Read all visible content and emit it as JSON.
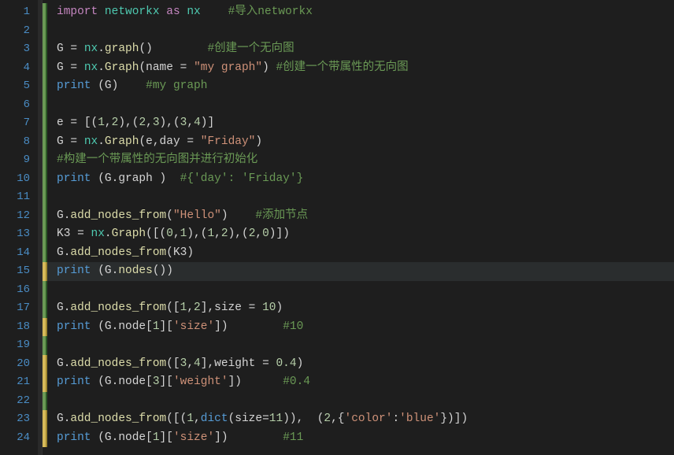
{
  "lines": [
    {
      "num": 1,
      "marker": "green",
      "current": false,
      "tokens": [
        [
          "kw",
          "import"
        ],
        [
          "id",
          " "
        ],
        [
          "mod",
          "networkx"
        ],
        [
          "id",
          " "
        ],
        [
          "kw",
          "as"
        ],
        [
          "id",
          " "
        ],
        [
          "fn",
          "nx"
        ],
        [
          "id",
          "    "
        ],
        [
          "cmt",
          "#导入networkx"
        ]
      ]
    },
    {
      "num": 2,
      "marker": "green",
      "current": false,
      "tokens": []
    },
    {
      "num": 3,
      "marker": "green",
      "current": false,
      "tokens": [
        [
          "id",
          "G "
        ],
        [
          "op",
          "="
        ],
        [
          "id",
          " "
        ],
        [
          "fn",
          "nx"
        ],
        [
          "punc",
          "."
        ],
        [
          "call",
          "graph"
        ],
        [
          "punc",
          "()"
        ],
        [
          "id",
          "        "
        ],
        [
          "cmt",
          "#创建一个无向图"
        ]
      ]
    },
    {
      "num": 4,
      "marker": "green",
      "current": false,
      "tokens": [
        [
          "id",
          "G "
        ],
        [
          "op",
          "="
        ],
        [
          "id",
          " "
        ],
        [
          "fn",
          "nx"
        ],
        [
          "punc",
          "."
        ],
        [
          "call",
          "Graph"
        ],
        [
          "punc",
          "("
        ],
        [
          "id",
          "name "
        ],
        [
          "op",
          "="
        ],
        [
          "id",
          " "
        ],
        [
          "str",
          "\"my graph\""
        ],
        [
          "punc",
          ")"
        ],
        [
          "id",
          " "
        ],
        [
          "cmt",
          "#创建一个带属性的无向图"
        ]
      ]
    },
    {
      "num": 5,
      "marker": "green",
      "current": false,
      "tokens": [
        [
          "pr",
          "print"
        ],
        [
          "id",
          " "
        ],
        [
          "punc",
          "("
        ],
        [
          "id",
          "G"
        ],
        [
          "punc",
          ")"
        ],
        [
          "id",
          "    "
        ],
        [
          "cmt",
          "#my graph"
        ]
      ]
    },
    {
      "num": 6,
      "marker": "green",
      "current": false,
      "tokens": []
    },
    {
      "num": 7,
      "marker": "green",
      "current": false,
      "tokens": [
        [
          "id",
          "e "
        ],
        [
          "op",
          "="
        ],
        [
          "id",
          " "
        ],
        [
          "punc",
          "[("
        ],
        [
          "num",
          "1"
        ],
        [
          "punc",
          ","
        ],
        [
          "num",
          "2"
        ],
        [
          "punc",
          "),("
        ],
        [
          "num",
          "2"
        ],
        [
          "punc",
          ","
        ],
        [
          "num",
          "3"
        ],
        [
          "punc",
          "),("
        ],
        [
          "num",
          "3"
        ],
        [
          "punc",
          ","
        ],
        [
          "num",
          "4"
        ],
        [
          "punc",
          ")]"
        ]
      ]
    },
    {
      "num": 8,
      "marker": "green",
      "current": false,
      "tokens": [
        [
          "id",
          "G "
        ],
        [
          "op",
          "="
        ],
        [
          "id",
          " "
        ],
        [
          "fn",
          "nx"
        ],
        [
          "punc",
          "."
        ],
        [
          "call",
          "Graph"
        ],
        [
          "punc",
          "("
        ],
        [
          "id",
          "e"
        ],
        [
          "punc",
          ","
        ],
        [
          "id",
          "day "
        ],
        [
          "op",
          "="
        ],
        [
          "id",
          " "
        ],
        [
          "str",
          "\"Friday\""
        ],
        [
          "punc",
          ")"
        ]
      ]
    },
    {
      "num": 9,
      "marker": "green",
      "current": false,
      "tokens": [
        [
          "cmt",
          "#构建一个带属性的无向图并进行初始化"
        ]
      ]
    },
    {
      "num": 10,
      "marker": "green",
      "current": false,
      "tokens": [
        [
          "pr",
          "print"
        ],
        [
          "id",
          " "
        ],
        [
          "punc",
          "("
        ],
        [
          "id",
          "G"
        ],
        [
          "punc",
          "."
        ],
        [
          "id",
          "graph "
        ],
        [
          "punc",
          ")"
        ],
        [
          "id",
          "  "
        ],
        [
          "cmt",
          "#{'day': 'Friday'}"
        ]
      ]
    },
    {
      "num": 11,
      "marker": "green",
      "current": false,
      "tokens": []
    },
    {
      "num": 12,
      "marker": "green",
      "current": false,
      "tokens": [
        [
          "id",
          "G"
        ],
        [
          "punc",
          "."
        ],
        [
          "call",
          "add_nodes_from"
        ],
        [
          "punc",
          "("
        ],
        [
          "str",
          "\"Hello\""
        ],
        [
          "punc",
          ")"
        ],
        [
          "id",
          "    "
        ],
        [
          "cmt",
          "#添加节点"
        ]
      ]
    },
    {
      "num": 13,
      "marker": "green",
      "current": false,
      "tokens": [
        [
          "id",
          "K3 "
        ],
        [
          "op",
          "="
        ],
        [
          "id",
          " "
        ],
        [
          "fn",
          "nx"
        ],
        [
          "punc",
          "."
        ],
        [
          "call",
          "Graph"
        ],
        [
          "punc",
          "([("
        ],
        [
          "num",
          "0"
        ],
        [
          "punc",
          ","
        ],
        [
          "num",
          "1"
        ],
        [
          "punc",
          "),("
        ],
        [
          "num",
          "1"
        ],
        [
          "punc",
          ","
        ],
        [
          "num",
          "2"
        ],
        [
          "punc",
          "),("
        ],
        [
          "num",
          "2"
        ],
        [
          "punc",
          ","
        ],
        [
          "num",
          "0"
        ],
        [
          "punc",
          ")])"
        ]
      ]
    },
    {
      "num": 14,
      "marker": "green",
      "current": false,
      "tokens": [
        [
          "id",
          "G"
        ],
        [
          "punc",
          "."
        ],
        [
          "call",
          "add_nodes_from"
        ],
        [
          "punc",
          "("
        ],
        [
          "id",
          "K3"
        ],
        [
          "punc",
          ")"
        ]
      ]
    },
    {
      "num": 15,
      "marker": "yellow",
      "current": true,
      "tokens": [
        [
          "pr",
          "print"
        ],
        [
          "id",
          " "
        ],
        [
          "punc",
          "("
        ],
        [
          "id",
          "G"
        ],
        [
          "punc",
          "."
        ],
        [
          "call",
          "nodes"
        ],
        [
          "punc",
          "())"
        ]
      ]
    },
    {
      "num": 16,
      "marker": "green",
      "current": false,
      "tokens": []
    },
    {
      "num": 17,
      "marker": "green",
      "current": false,
      "tokens": [
        [
          "id",
          "G"
        ],
        [
          "punc",
          "."
        ],
        [
          "call",
          "add_nodes_from"
        ],
        [
          "punc",
          "(["
        ],
        [
          "num",
          "1"
        ],
        [
          "punc",
          ","
        ],
        [
          "num",
          "2"
        ],
        [
          "punc",
          "],"
        ],
        [
          "id",
          "size "
        ],
        [
          "op",
          "="
        ],
        [
          "id",
          " "
        ],
        [
          "num",
          "10"
        ],
        [
          "punc",
          ")"
        ]
      ]
    },
    {
      "num": 18,
      "marker": "yellow",
      "current": false,
      "tokens": [
        [
          "pr",
          "print"
        ],
        [
          "id",
          " "
        ],
        [
          "punc",
          "("
        ],
        [
          "id",
          "G"
        ],
        [
          "punc",
          "."
        ],
        [
          "id",
          "node"
        ],
        [
          "punc",
          "["
        ],
        [
          "num",
          "1"
        ],
        [
          "punc",
          "]["
        ],
        [
          "str",
          "'size'"
        ],
        [
          "punc",
          "])"
        ],
        [
          "id",
          "        "
        ],
        [
          "cmt",
          "#10"
        ]
      ]
    },
    {
      "num": 19,
      "marker": "green",
      "current": false,
      "tokens": []
    },
    {
      "num": 20,
      "marker": "yellow",
      "current": false,
      "tokens": [
        [
          "id",
          "G"
        ],
        [
          "punc",
          "."
        ],
        [
          "call",
          "add_nodes_from"
        ],
        [
          "punc",
          "(["
        ],
        [
          "num",
          "3"
        ],
        [
          "punc",
          ","
        ],
        [
          "num",
          "4"
        ],
        [
          "punc",
          "],"
        ],
        [
          "id",
          "weight "
        ],
        [
          "op",
          "="
        ],
        [
          "id",
          " "
        ],
        [
          "num",
          "0.4"
        ],
        [
          "punc",
          ")"
        ]
      ]
    },
    {
      "num": 21,
      "marker": "yellow",
      "current": false,
      "tokens": [
        [
          "pr",
          "print"
        ],
        [
          "id",
          " "
        ],
        [
          "punc",
          "("
        ],
        [
          "id",
          "G"
        ],
        [
          "punc",
          "."
        ],
        [
          "id",
          "node"
        ],
        [
          "punc",
          "["
        ],
        [
          "num",
          "3"
        ],
        [
          "punc",
          "]["
        ],
        [
          "str",
          "'weight'"
        ],
        [
          "punc",
          "])"
        ],
        [
          "id",
          "      "
        ],
        [
          "cmt",
          "#0.4"
        ]
      ]
    },
    {
      "num": 22,
      "marker": "green",
      "current": false,
      "tokens": []
    },
    {
      "num": 23,
      "marker": "yellow",
      "current": false,
      "tokens": [
        [
          "id",
          "G"
        ],
        [
          "punc",
          "."
        ],
        [
          "call",
          "add_nodes_from"
        ],
        [
          "punc",
          "([("
        ],
        [
          "num",
          "1"
        ],
        [
          "punc",
          ","
        ],
        [
          "kw3",
          "dict"
        ],
        [
          "punc",
          "("
        ],
        [
          "id",
          "size"
        ],
        [
          "op",
          "="
        ],
        [
          "num",
          "11"
        ],
        [
          "punc",
          ")),  ("
        ],
        [
          "num",
          "2"
        ],
        [
          "punc",
          ",{"
        ],
        [
          "str",
          "'color'"
        ],
        [
          "punc",
          ":"
        ],
        [
          "str",
          "'blue'"
        ],
        [
          "punc",
          "})])"
        ]
      ]
    },
    {
      "num": 24,
      "marker": "yellow",
      "current": false,
      "tokens": [
        [
          "pr",
          "print"
        ],
        [
          "id",
          " "
        ],
        [
          "punc",
          "("
        ],
        [
          "id",
          "G"
        ],
        [
          "punc",
          "."
        ],
        [
          "id",
          "node"
        ],
        [
          "punc",
          "["
        ],
        [
          "num",
          "1"
        ],
        [
          "punc",
          "]["
        ],
        [
          "str",
          "'size'"
        ],
        [
          "punc",
          "])"
        ],
        [
          "id",
          "        "
        ],
        [
          "cmt",
          "#11"
        ]
      ]
    }
  ]
}
